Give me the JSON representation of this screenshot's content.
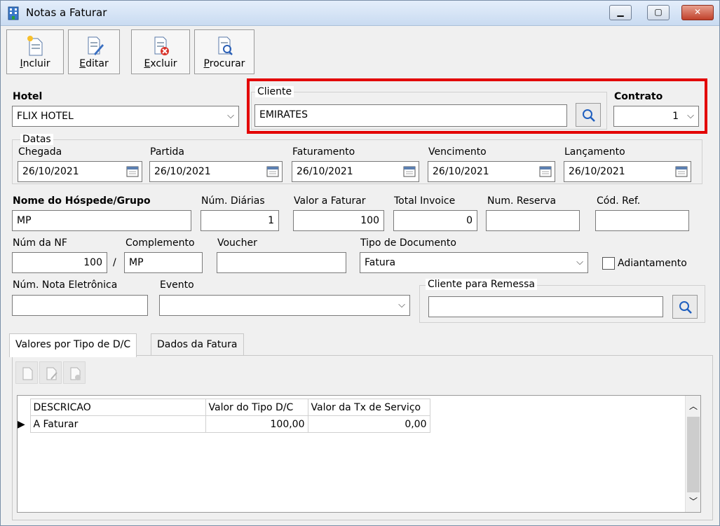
{
  "window": {
    "title": "Notas a Faturar"
  },
  "toolbar": {
    "incluir": {
      "key": "I",
      "rest": "ncluir"
    },
    "editar": {
      "key": "E",
      "rest": "ditar"
    },
    "excluir": {
      "key": "E",
      "rest": "xcluir"
    },
    "procurar": {
      "key": "P",
      "rest": "rocurar"
    }
  },
  "form": {
    "hotel": {
      "label": "Hotel",
      "value": "FLIX HOTEL"
    },
    "cliente": {
      "label": "Cliente",
      "value": "EMIRATES"
    },
    "contrato": {
      "label": "Contrato",
      "value": "1"
    },
    "datas": {
      "label": "Datas",
      "chegada": {
        "label": "Chegada",
        "value": "26/10/2021"
      },
      "partida": {
        "label": "Partida",
        "value": "26/10/2021"
      },
      "faturamento": {
        "label": "Faturamento",
        "value": "26/10/2021"
      },
      "vencimento": {
        "label": "Vencimento",
        "value": "26/10/2021"
      },
      "lancamento": {
        "label": "Lançamento",
        "value": "26/10/2021"
      }
    },
    "hospede": {
      "label": "Nome do Hóspede/Grupo",
      "value": "MP"
    },
    "diarias": {
      "label": "Núm. Diárias",
      "value": "1"
    },
    "valor_faturar": {
      "label": "Valor a Faturar",
      "value": "100"
    },
    "total_invoice": {
      "label": "Total Invoice",
      "value": "0"
    },
    "num_reserva": {
      "label": "Num. Reserva",
      "value": ""
    },
    "cod_ref": {
      "label": "Cód. Ref.",
      "value": ""
    },
    "num_nf": {
      "label": "Núm da NF",
      "value": "100"
    },
    "separator": "/",
    "complemento": {
      "label": "Complemento",
      "value": "MP"
    },
    "voucher": {
      "label": "Voucher",
      "value": ""
    },
    "tipo_documento": {
      "label": "Tipo de Documento",
      "value": "Fatura"
    },
    "adiantamento": {
      "label": "Adiantamento"
    },
    "nota_eletronica": {
      "label": "Núm. Nota Eletrônica",
      "value": ""
    },
    "evento": {
      "label": "Evento",
      "value": ""
    },
    "cliente_remessa": {
      "label": "Cliente para Remessa",
      "value": ""
    }
  },
  "tabs": [
    {
      "label": "Valores por Tipo de D/C"
    },
    {
      "label": "Dados da Fatura"
    }
  ],
  "grid": {
    "columns": [
      "DESCRICAO",
      "Valor do Tipo D/C",
      "Valor da Tx de Serviço"
    ],
    "rows": [
      {
        "descricao": "A Faturar",
        "valor_tipo": "100,00",
        "valor_tx": "0,00"
      }
    ]
  }
}
